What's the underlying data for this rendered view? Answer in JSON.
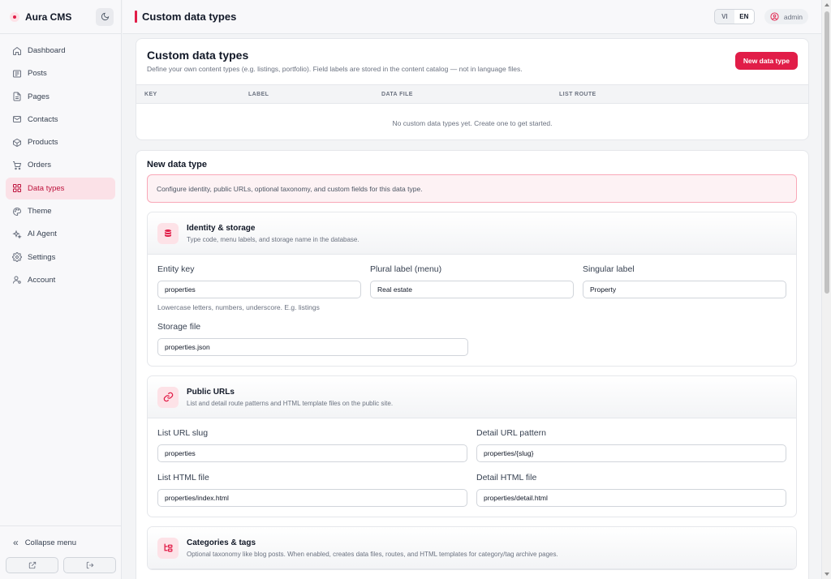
{
  "app": {
    "name": "Aura CMS"
  },
  "sidebar": {
    "items": [
      {
        "label": "Dashboard",
        "icon": "home-icon",
        "active": false
      },
      {
        "label": "Posts",
        "icon": "posts-icon",
        "active": false
      },
      {
        "label": "Pages",
        "icon": "pages-icon",
        "active": false
      },
      {
        "label": "Contacts",
        "icon": "mail-icon",
        "active": false
      },
      {
        "label": "Products",
        "icon": "box-icon",
        "active": false
      },
      {
        "label": "Orders",
        "icon": "cart-icon",
        "active": false
      },
      {
        "label": "Data types",
        "icon": "grid-icon",
        "active": true
      },
      {
        "label": "Theme",
        "icon": "palette-icon",
        "active": false
      },
      {
        "label": "AI Agent",
        "icon": "sparkle-icon",
        "active": false
      },
      {
        "label": "Settings",
        "icon": "gear-icon",
        "active": false
      },
      {
        "label": "Account",
        "icon": "user-icon",
        "active": false
      }
    ],
    "collapse_label": "Collapse menu"
  },
  "header": {
    "title": "Custom data types",
    "languages": [
      "VI",
      "EN"
    ],
    "selected_language": "EN",
    "user": "admin"
  },
  "list_card": {
    "title": "Custom data types",
    "subtitle": "Define your own content types (e.g. listings, portfolio). Field labels are stored in the content catalog — not in language files.",
    "new_button": "New data type",
    "columns": [
      "KEY",
      "LABEL",
      "DATA FILE",
      "LIST ROUTE"
    ],
    "empty_text": "No custom data types yet. Create one to get started."
  },
  "form": {
    "title": "New data type",
    "info": "Configure identity, public URLs, optional taxonomy, and custom fields for this data type.",
    "identity": {
      "title": "Identity & storage",
      "subtitle": "Type code, menu labels, and storage name in the database.",
      "entity_key_label": "Entity key",
      "entity_key_value": "properties",
      "entity_key_hint": "Lowercase letters, numbers, underscore. E.g. listings",
      "plural_label": "Plural label (menu)",
      "plural_value": "Real estate",
      "singular_label": "Singular label",
      "singular_value": "Property",
      "storage_label": "Storage file",
      "storage_value": "properties.json"
    },
    "urls": {
      "title": "Public URLs",
      "subtitle": "List and detail route patterns and HTML template files on the public site.",
      "list_slug_label": "List URL slug",
      "list_slug_value": "properties",
      "detail_pattern_label": "Detail URL pattern",
      "detail_pattern_value": "properties/{slug}",
      "list_html_label": "List HTML file",
      "list_html_value": "properties/index.html",
      "detail_html_label": "Detail HTML file",
      "detail_html_value": "properties/detail.html"
    },
    "taxonomy": {
      "title": "Categories & tags",
      "subtitle": "Optional taxonomy like blog posts. When enabled, creates data files, routes, and HTML templates for category/tag archive pages."
    }
  },
  "colors": {
    "accent": "#e11d48",
    "active_bg": "#fbe1e7"
  }
}
